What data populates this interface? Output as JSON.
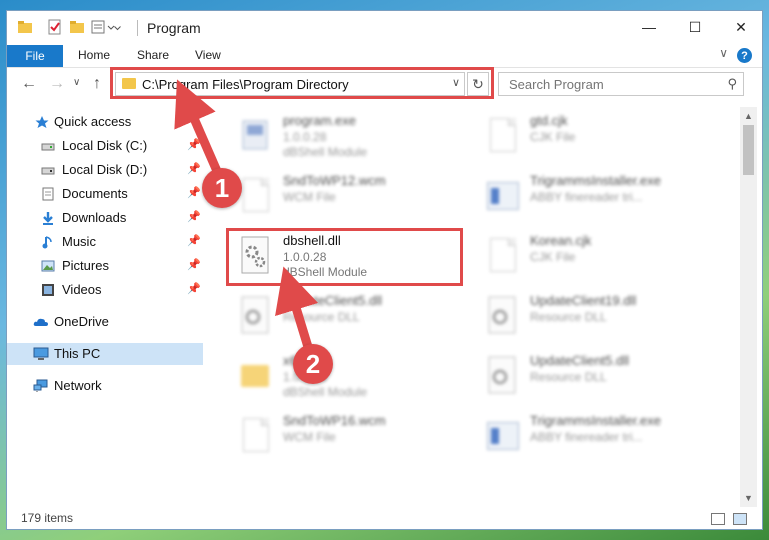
{
  "window": {
    "title": "Program",
    "minimize": "—",
    "maximize": "☐",
    "close": "✕"
  },
  "ribbon": {
    "tabs": [
      "File",
      "Home",
      "Share",
      "View"
    ],
    "help": "?"
  },
  "address": {
    "path": "C:\\Program Files\\Program Directory"
  },
  "search": {
    "placeholder": "Search Program"
  },
  "sidebar": {
    "items": [
      {
        "label": "Quick access",
        "icon": "star-icon"
      },
      {
        "label": "Local Disk (C:)",
        "icon": "drive-icon",
        "pinned": true
      },
      {
        "label": "Local Disk (D:)",
        "icon": "drive-icon",
        "pinned": true
      },
      {
        "label": "Documents",
        "icon": "documents-icon",
        "pinned": true
      },
      {
        "label": "Downloads",
        "icon": "download-icon",
        "pinned": true
      },
      {
        "label": "Music",
        "icon": "music-icon",
        "pinned": true
      },
      {
        "label": "Pictures",
        "icon": "pictures-icon",
        "pinned": true
      },
      {
        "label": "Videos",
        "icon": "videos-icon",
        "pinned": true
      },
      {
        "label": "OneDrive",
        "icon": "cloud-icon"
      },
      {
        "label": "This PC",
        "icon": "computer-icon",
        "selected": true
      },
      {
        "label": "Network",
        "icon": "network-icon"
      }
    ]
  },
  "files": [
    {
      "name": "program.exe",
      "line1": "1.0.0.28",
      "line2": "dBShell Module",
      "icon": "app",
      "blurred": true
    },
    {
      "name": "gtd.cjk",
      "line1": "CJK File",
      "line2": "",
      "icon": "doc",
      "blurred": true
    },
    {
      "name": "SndToWP12.wcm",
      "line1": "WCM File",
      "line2": "",
      "icon": "doc",
      "blurred": true
    },
    {
      "name": "TrigrammsInstaller.exe",
      "line1": "ABBY finereader tri...",
      "line2": "",
      "icon": "exe",
      "blurred": true
    },
    {
      "name": "dbshell.dll",
      "line1": "1.0.0.28",
      "line2": "dBShell Module",
      "icon": "gear",
      "blurred": false
    },
    {
      "name": "Korean.cjk",
      "line1": "CJK File",
      "line2": "",
      "icon": "doc",
      "blurred": true
    },
    {
      "name": "UpdateClient5.dll",
      "line1": "Resource DLL",
      "line2": "",
      "icon": "gear",
      "blurred": true
    },
    {
      "name": "UpdateClient19.dll",
      "line1": "Resource DLL",
      "line2": "",
      "icon": "gear",
      "blurred": true
    },
    {
      "name": "x64",
      "line1": "1.0.0.28",
      "line2": "dBShell Module",
      "icon": "folder",
      "blurred": true
    },
    {
      "name": "UpdateClient5.dll",
      "line1": "Resource DLL",
      "line2": "",
      "icon": "gear",
      "blurred": true
    },
    {
      "name": "SndToWP16.wcm",
      "line1": "WCM File",
      "line2": "",
      "icon": "doc",
      "blurred": true
    },
    {
      "name": "TrigrammsInstaller.exe",
      "line1": "ABBY finereader tri...",
      "line2": "",
      "icon": "exe",
      "blurred": true
    }
  ],
  "status": {
    "count": "179 items"
  },
  "annotations": {
    "badge1": "1",
    "badge2": "2",
    "color": "#e04a4a"
  }
}
